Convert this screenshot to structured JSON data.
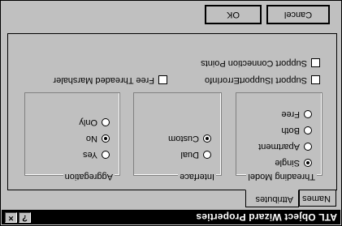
{
  "window": {
    "title": "ATL Object Wizard Properties",
    "help_glyph": "?",
    "close_glyph": "×"
  },
  "tabs": [
    {
      "label": "Names"
    },
    {
      "label": "Attributes"
    }
  ],
  "threading_model": {
    "label": "Threading Model",
    "options": [
      "Single",
      "Apartment",
      "Both",
      "Free"
    ],
    "selected": "Single"
  },
  "interface": {
    "label": "Interface",
    "options": [
      "Dual",
      "Custom"
    ],
    "selected": "Custom"
  },
  "aggregation": {
    "label": "Aggregation",
    "options": [
      "Yes",
      "No",
      "Only"
    ],
    "selected": "No"
  },
  "checkboxes": {
    "support_isupporterrorinfo": "Support ISupportErrorInfo",
    "support_connection_points": "Support Connection Points",
    "free_threaded_marshaler": "Free Threaded Marshaler"
  },
  "buttons": {
    "ok": "OK",
    "cancel": "Cancel"
  }
}
